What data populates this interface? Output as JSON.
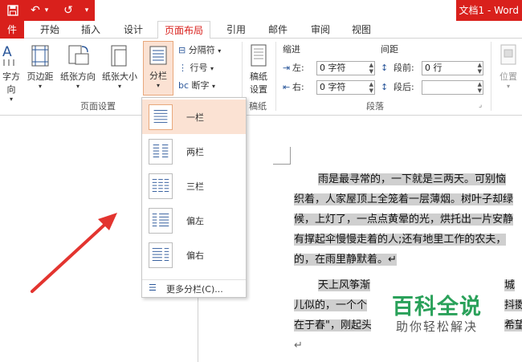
{
  "titlebar": {
    "save_icon": "save-icon",
    "undo_glyph": "↶",
    "redo_glyph": "↺",
    "dropdown_glyph": "▾",
    "doc_title": "文档1 - Word",
    "bg_color": "#d9201c"
  },
  "tabs": {
    "file": "件",
    "home": "开始",
    "insert": "插入",
    "design": "设计",
    "layout": "页面布局",
    "references": "引用",
    "mailings": "邮件",
    "review": "审阅",
    "view": "视图"
  },
  "ribbon": {
    "text_direction": "字方向",
    "margins": "页边距",
    "orientation": "纸张方向",
    "size": "纸张大小",
    "columns": "分栏",
    "breaks": "分隔符",
    "line_numbers": "行号",
    "hyphenation": "断字",
    "page_setup_group": "页面设置",
    "paper_group": "稿纸",
    "paper_btn_line1": "稿纸",
    "paper_btn_line2": "设置",
    "indent_label": "缩进",
    "spacing_label": "间距",
    "indent_left_label": "左:",
    "indent_left_value": "0 字符",
    "indent_right_label": "右:",
    "indent_right_value": "0 字符",
    "spacing_before_label": "段前:",
    "spacing_before_value": "0 行",
    "spacing_after_label": "段后:",
    "spacing_after_value": "",
    "paragraph_group": "段落",
    "position": "位置"
  },
  "columns_menu": {
    "items": [
      {
        "label": "一栏",
        "selected": true
      },
      {
        "label": "两栏",
        "selected": false
      },
      {
        "label": "三栏",
        "selected": false
      },
      {
        "label": "偏左",
        "selected": false
      },
      {
        "label": "偏右",
        "selected": false
      }
    ],
    "more": "更多分栏(C)..."
  },
  "document": {
    "para1": [
      "雨是最寻常的，一下就是三两天。可别恼",
      "织着，人家屋顶上全笼着一层薄烟。树叶子却绿",
      "候，上灯了，一点点黄晕的光，烘托出一片安静",
      "有撑起伞慢慢走着的人;还有地里工作的农夫，",
      "的，在雨里静默着。↵"
    ],
    "para2": [
      "天上风筝渐",
      "儿似的，一个个",
      "在于春\"，刚起头"
    ],
    "para2_right": [
      "城",
      "抖擞",
      "希望"
    ],
    "trailing_mark": "↵"
  },
  "watermark": {
    "title": "百科全说",
    "subtitle": "助你轻松解决"
  }
}
